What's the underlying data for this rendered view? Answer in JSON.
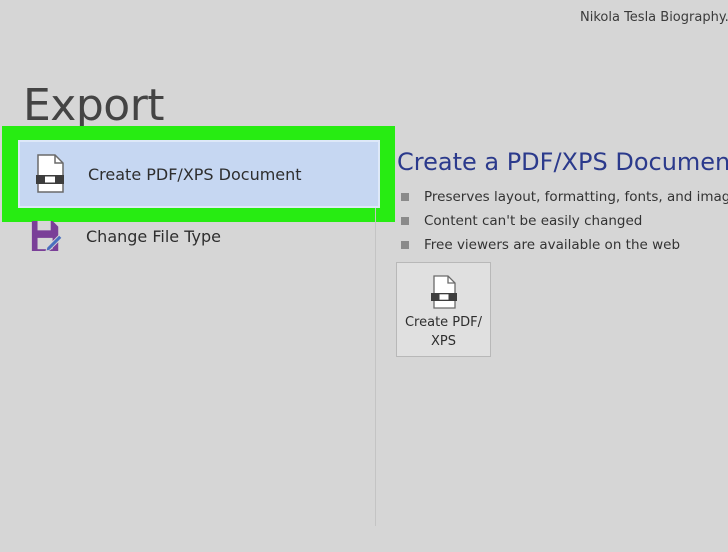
{
  "window": {
    "document_title": "Nikola Tesla Biography.docx"
  },
  "page": {
    "title": "Export"
  },
  "options": [
    {
      "label": "Create PDF/XPS Document",
      "icon": "pdf-document-icon",
      "selected": true
    },
    {
      "label": "Change File Type",
      "icon": "change-file-type-icon",
      "selected": false
    }
  ],
  "detail": {
    "heading": "Create a PDF/XPS Document",
    "bullets": [
      "Preserves layout, formatting, fonts, and images",
      "Content can't be easily changed",
      "Free viewers are available on the web"
    ],
    "button_label": "Create PDF/ XPS"
  },
  "colors": {
    "highlight": "#27ec12",
    "selected_bg": "#c6d7f2",
    "heading": "#2b3a8c",
    "background": "#d6d6d6",
    "filetype_icon": "#7a3f98"
  }
}
